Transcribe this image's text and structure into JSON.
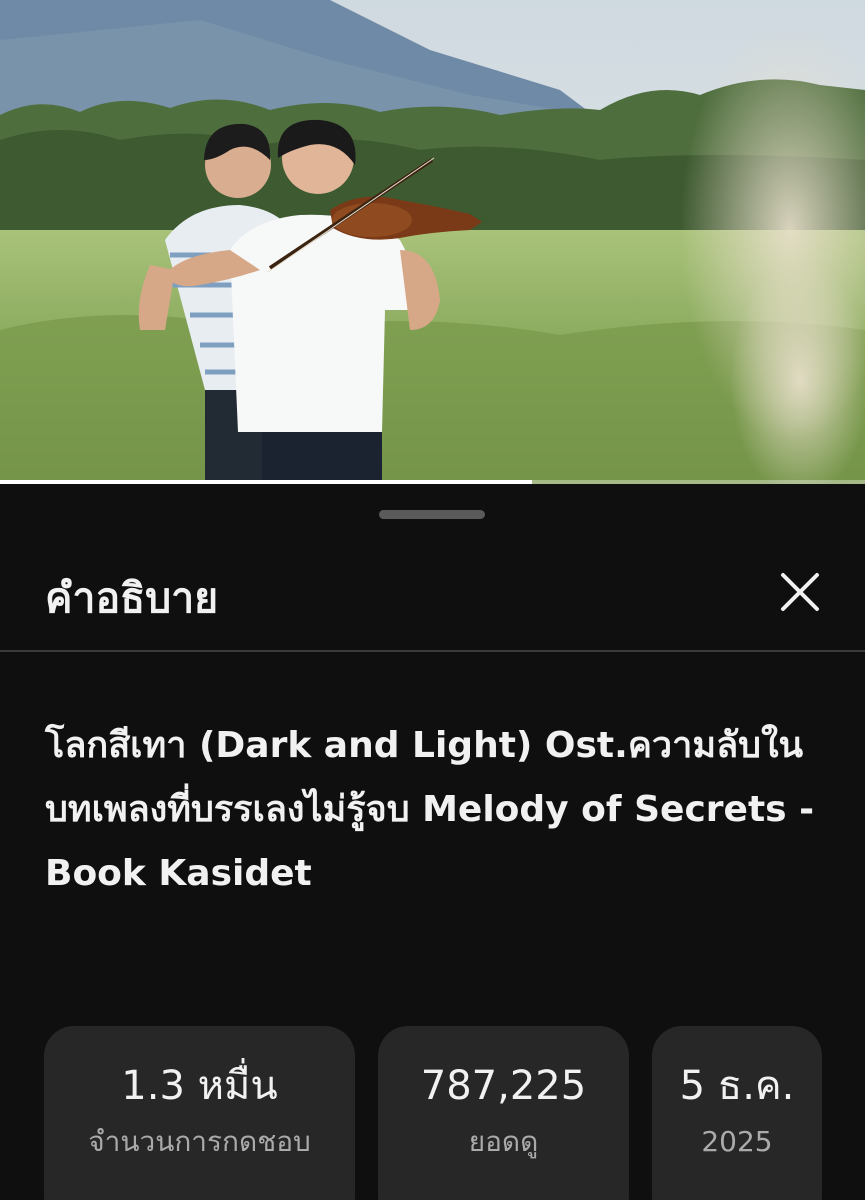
{
  "video": {
    "progress_fraction": 0.615
  },
  "sheet": {
    "title": "คำอธิบาย",
    "close_icon": "close-icon"
  },
  "description": {
    "title": "โลกสีเทา (Dark and Light) Ost.ความลับในบทเพลงที่บรรเลงไม่รู้จบ Melody of Secrets - Book Kasidet"
  },
  "stats": {
    "likes": {
      "value": "1.3 หมื่น",
      "label": "จำนวนการกดชอบ"
    },
    "views": {
      "value": "787,225",
      "label": "ยอดดู"
    },
    "date": {
      "value": "5 ธ.ค.",
      "label": "2025"
    }
  },
  "colors": {
    "background": "#0f0f0f",
    "chip": "#272727",
    "text_primary": "#f1f1f1",
    "text_secondary": "#aaaaaa"
  }
}
